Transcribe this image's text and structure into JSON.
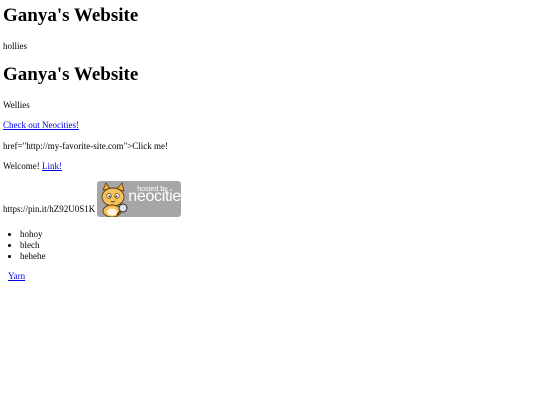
{
  "titles": [
    "Ganya's Website",
    "Ganya's Website"
  ],
  "paragraphs": {
    "hollies": "hollies",
    "wellies": "Wellies",
    "neocities_link": "Check out Neocities!",
    "href_text": "href=\"http://my-favorite-site.com\">Click me!",
    "welcome_prefix": "Welcome! ",
    "welcome_link": "Link!",
    "pin_url": "https://pin.it/hZ92U0S1K"
  },
  "badge": {
    "hosted_text": "hosted by",
    "brand_text": "neocities",
    "icon": "neocities-cat-mascot-icon",
    "background": "#a6a6a6"
  },
  "list_1": [
    "hohoy",
    "blech",
    "hehehe"
  ],
  "list_2": [
    "Yarn"
  ],
  "colors": {
    "link": "#0000ee",
    "text": "#000000",
    "background": "#ffffff"
  }
}
